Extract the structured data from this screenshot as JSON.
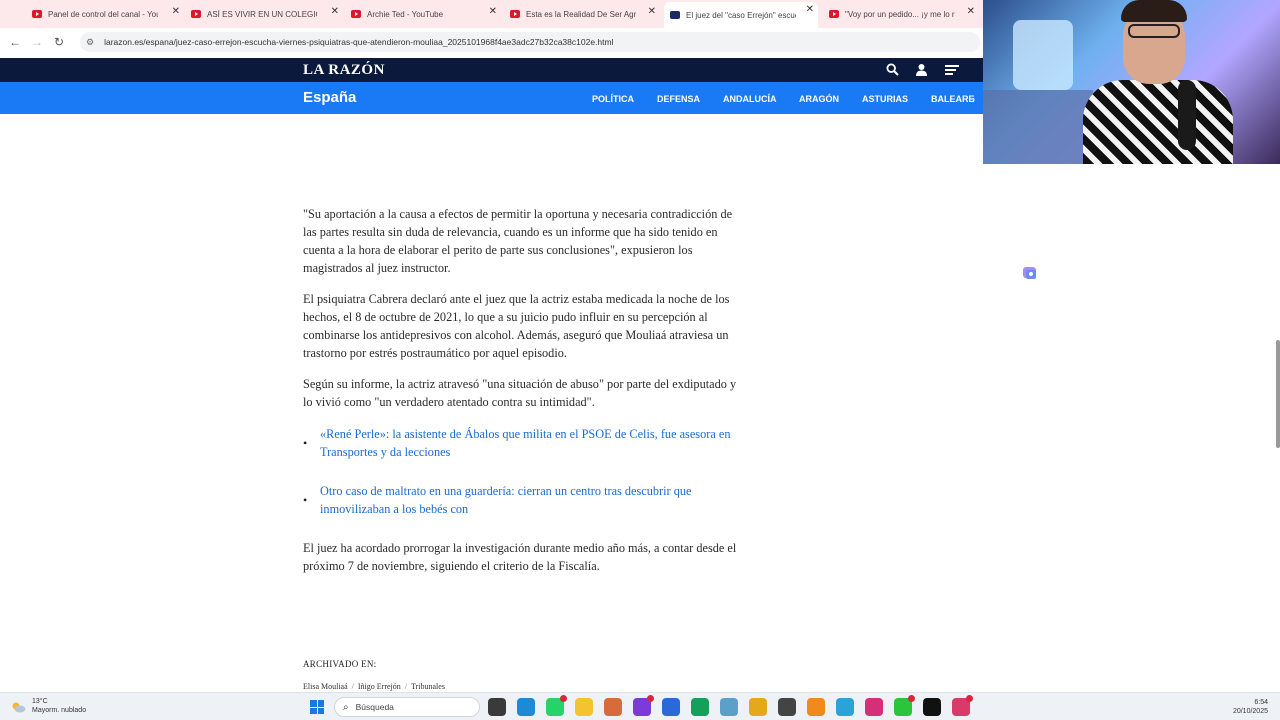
{
  "browser": {
    "tabs": [
      {
        "title": "Panel de control del canal - You",
        "icon": "youtube-icon",
        "active": false
      },
      {
        "title": "ASÍ ES VIVIR EN UN COLEGIO M",
        "icon": "youtube-icon",
        "active": false
      },
      {
        "title": "Archie Ted - YouTube",
        "icon": "youtube-icon",
        "active": false
      },
      {
        "title": "Esta es la Realidad De Ser Agri",
        "icon": "youtube-icon",
        "active": false
      },
      {
        "title": "El juez del \"caso Errejón\" escuch",
        "icon": "larazon-icon",
        "active": true
      },
      {
        "title": "\"Voy por un pedido... ¡y me lo r",
        "icon": "youtube-icon",
        "active": false
      }
    ],
    "url": "larazon.es/espana/juez-caso-errejon-escucha-viernes-psiquiatras-que-atendieron-mouliaa_2025101968f4ae3adc27b32ca38c102e.html"
  },
  "site": {
    "logo": "LA RAZÓN",
    "section": "España",
    "nav": [
      "POLÍTICA",
      "DEFENSA",
      "ANDALUCÍA",
      "ARAGÓN",
      "ASTURIAS",
      "BALEARE"
    ],
    "more_arrow": "›"
  },
  "article": {
    "paragraphs": [
      "\"Su aportación a la causa a efectos de permitir la oportuna y necesaria contradicción de las partes resulta sin duda de relevancia, cuando es un informe que ha sido tenido en cuenta a la hora de elaborar el perito de parte sus conclusiones\", expusieron los magistrados al juez instructor.",
      "El psiquiatra Cabrera declaró ante el juez que la actriz estaba medicada la noche de los hechos, el 8 de octubre de 2021, lo que a su juicio pudo influir en su percepción al combinarse los antidepresivos con alcohol. Además, aseguró que Mouliaá atraviesa un trastorno por estrés postraumático por aquel episodio.",
      "Según su informe, la actriz atravesó \"una situación de abuso\" por parte del exdiputado y lo vivió como \"un verdadero atentado contra su intimidad\"."
    ],
    "related": [
      "«René Perle»: la asistente de Ábalos que milita en el PSOE de Celis, fue asesora en Transportes y da lecciones",
      "Otro caso de maltrato en una guardería: cierran un centro tras descubrir que inmovilizaban a los bebés con"
    ],
    "closing": "El juez ha acordado prorrogar la investigación durante medio año más, a contar desde el próximo 7 de noviembre, siguiendo el criterio de la Fiscalía.",
    "archived_label": "ARCHIVADO EN:",
    "tags": [
      "Elisa Mouliaá",
      "Iñigo Errejón",
      "Tribunales"
    ],
    "tag_separator": "/"
  },
  "taskbar": {
    "weather_temp": "13°C",
    "weather_desc": "Mayorm. nublado",
    "search_placeholder": "Búsqueda",
    "time": "6:54",
    "date": "20/10/2025",
    "apps": [
      {
        "name": "task-view-icon",
        "color": "#3a3a3a",
        "badge": false
      },
      {
        "name": "edge-icon",
        "color": "#1d8ad8",
        "badge": false
      },
      {
        "name": "whatsapp-icon",
        "color": "#25d366",
        "badge": true
      },
      {
        "name": "file-explorer-icon",
        "color": "#f4c430",
        "badge": false
      },
      {
        "name": "paint-icon",
        "color": "#d86b3c",
        "badge": false
      },
      {
        "name": "video-editor-icon",
        "color": "#7c3ad8",
        "badge": true
      },
      {
        "name": "store-icon",
        "color": "#2a6ad8",
        "badge": false
      },
      {
        "name": "xbox-icon",
        "color": "#14a05a",
        "badge": false
      },
      {
        "name": "feather-icon",
        "color": "#5aa0c8",
        "badge": false
      },
      {
        "name": "chrome-icon",
        "color": "#e5a81a",
        "badge": false
      },
      {
        "name": "calculator-icon",
        "color": "#444444",
        "badge": false
      },
      {
        "name": "rtve-icon",
        "color": "#f08a1c",
        "badge": false
      },
      {
        "name": "telegram-icon",
        "color": "#2aa3d8",
        "badge": false
      },
      {
        "name": "instagram-icon",
        "color": "#d62f7a",
        "badge": false
      },
      {
        "name": "kick-icon",
        "color": "#2bc43a",
        "badge": true
      },
      {
        "name": "tiktok-icon",
        "color": "#111111",
        "badge": false
      },
      {
        "name": "chrome-canary-icon",
        "color": "#d83a6a",
        "badge": true
      }
    ]
  },
  "colors": {
    "site_navy": "#0b1a3c",
    "site_blue": "#1a7af5",
    "link_blue": "#1a6ad6",
    "youtube_red": "#e0162b"
  }
}
